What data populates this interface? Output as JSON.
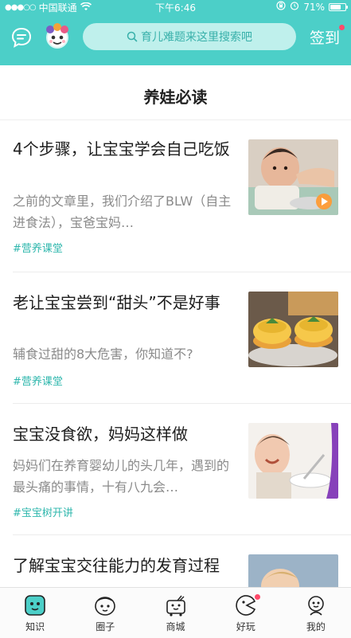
{
  "status_bar": {
    "carrier": "中国联通",
    "time": "下午6:46",
    "battery": "71%",
    "battery_level": 0.71
  },
  "nav": {
    "search_placeholder": "育儿难题来这里搜索吧",
    "checkin_label": "签到"
  },
  "section": {
    "title": "养娃必读"
  },
  "articles": [
    {
      "title": "4个步骤，让宝宝学会自己吃饭",
      "desc": "之前的文章里，我们介绍了BLW（自主进食法），宝爸宝妈…",
      "tag": "#营养课堂"
    },
    {
      "title": "老让宝宝尝到“甜头”不是好事",
      "desc": "辅食过甜的8大危害，你知道不?",
      "tag": "#营养课堂"
    },
    {
      "title": "宝宝没食欲，妈妈这样做",
      "desc": "妈妈们在养育婴幼儿的头几年，遇到的最头痛的事情，十有八九会…",
      "tag": "#宝宝树开讲"
    },
    {
      "title": "了解宝宝交往能力的发育过程"
    }
  ],
  "tabs": [
    {
      "label": "知识",
      "icon": "knowledge-icon",
      "active": true
    },
    {
      "label": "圈子",
      "icon": "circle-icon"
    },
    {
      "label": "商城",
      "icon": "mall-icon"
    },
    {
      "label": "好玩",
      "icon": "fun-icon",
      "badge": true
    },
    {
      "label": "我的",
      "icon": "me-icon"
    }
  ],
  "colors": {
    "brand": "#4ccfc8",
    "tag": "#2fb7ad",
    "badge": "#ff4a6a"
  }
}
